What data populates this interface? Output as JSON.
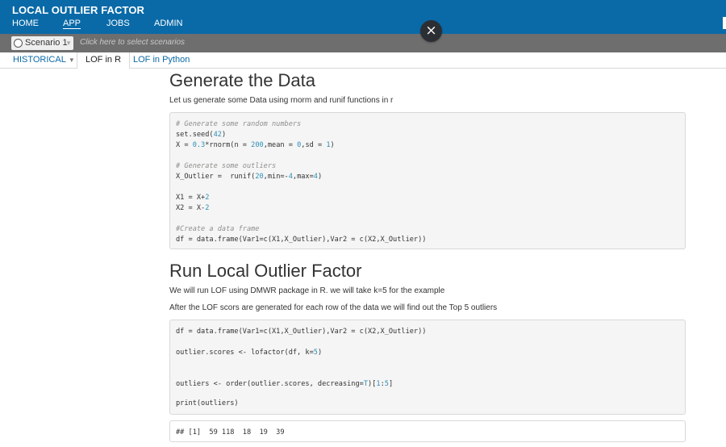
{
  "header": {
    "app_title": "LOCAL OUTLIER FACTOR",
    "nav": [
      {
        "label": "HOME"
      },
      {
        "label": "APP",
        "active": true
      },
      {
        "label": "JOBS"
      },
      {
        "label": "ADMIN"
      }
    ],
    "close_symbol": "×"
  },
  "scenario_bar": {
    "selected": "Scenario 1",
    "placeholder": "Click here to select scenarios"
  },
  "tabs": [
    {
      "label": "HISTORICAL",
      "has_dropdown": true
    },
    {
      "label": "LOF in R",
      "active": true
    },
    {
      "label": "LOF in Python"
    }
  ],
  "main": {
    "section1": {
      "title": "Generate the Data",
      "intro": "Let us generate some Data using rnorm and runif functions in r",
      "code_lines": [
        "# Generate some random numbers",
        "set.seed(42)",
        "X = 0.3*rnorm(n = 200,mean = 0,sd = 1)",
        "",
        "# Generate some outliers",
        "X_Outlier =  runif(20,min=-4,max=4)",
        "",
        "X1 = X+2",
        "X2 = X-2",
        "",
        "#Create a data frame",
        "df = data.frame(Var1=c(X1,X_Outlier),Var2 = c(X2,X_Outlier))"
      ]
    },
    "section2": {
      "title": "Run Local Outlier Factor",
      "para1": "We will run LOF using DMWR package in R. we will take k=5 for the example",
      "para2": "After the LOF scors are generated for each row of the data we will find out the Top 5 outliers",
      "code_lines": [
        "df = data.frame(Var1=c(X1,X_Outlier),Var2 = c(X2,X_Outlier))",
        "",
        "outlier.scores <- lofactor(df, k=5)",
        "",
        "",
        "outliers <- order(outlier.scores, decreasing=T)[1:5]",
        "",
        "print(outliers)"
      ],
      "output": "## [1]  59 118  18  19  39"
    }
  },
  "colors": {
    "header_bg": "#0a6aa8",
    "scenario_bar_bg": "#6e6e6e",
    "code_bg": "#f5f5f5",
    "number_color": "#2e8fb6",
    "comment_color": "#8e908c"
  }
}
